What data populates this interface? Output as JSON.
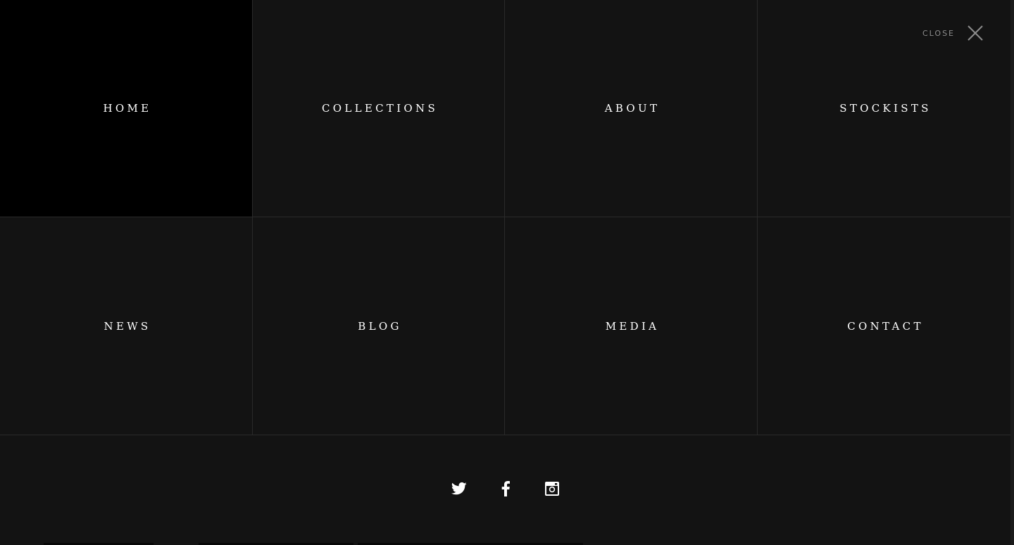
{
  "close": {
    "label": "CLOSE",
    "icon": "close-icon"
  },
  "menu": {
    "items": [
      {
        "label": "HOME",
        "active": true
      },
      {
        "label": "COLLECTIONS",
        "active": false
      },
      {
        "label": "ABOUT",
        "active": false
      },
      {
        "label": "STOCKISTS",
        "active": false
      },
      {
        "label": "NEWS",
        "active": false
      },
      {
        "label": "BLOG",
        "active": false
      },
      {
        "label": "MEDIA",
        "active": false
      },
      {
        "label": "CONTACT",
        "active": false
      }
    ]
  },
  "social": {
    "icons": [
      "twitter-icon",
      "facebook-icon",
      "instagram-icon"
    ]
  },
  "colors": {
    "background": "#131313",
    "active_cell": "#000000",
    "divider": "#2a2a2a",
    "text": "#ffffff",
    "close_text": "#8c8c8c"
  }
}
